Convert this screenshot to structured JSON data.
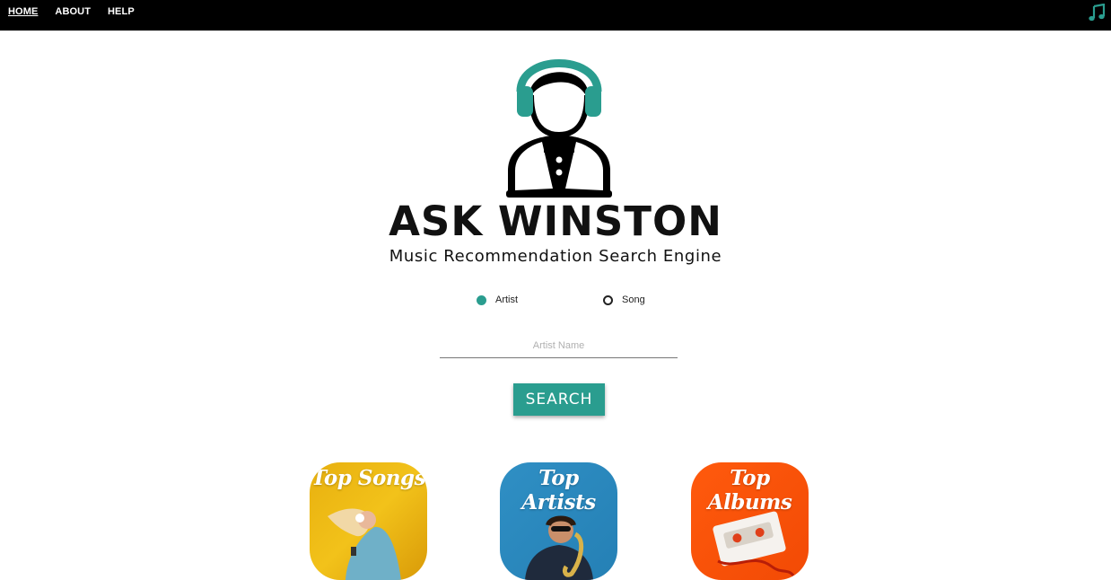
{
  "nav": {
    "items": [
      {
        "label": "HOME",
        "active": true
      },
      {
        "label": "ABOUT",
        "active": false
      },
      {
        "label": "HELP",
        "active": false
      }
    ],
    "music_icon": "music-note-icon"
  },
  "brand": {
    "logo_icon": "headphones-person-logo",
    "title": "ASK WINSTON",
    "subtitle": "Music Recommendation Search Engine"
  },
  "search_type": {
    "options": [
      {
        "label": "Artist",
        "checked": true
      },
      {
        "label": "Song",
        "checked": false
      }
    ]
  },
  "search": {
    "placeholder": "Artist Name",
    "value": "",
    "button_label": "SEARCH"
  },
  "tiles": [
    {
      "label": "Top Songs",
      "image": "woman-with-headphones-dancing"
    },
    {
      "label": "Top Artists",
      "image": "saxophone-player"
    },
    {
      "label": "Top Albums",
      "image": "cassette-tape"
    }
  ],
  "colors": {
    "accent": "#2a9d8f",
    "nav_bg": "#000000",
    "songs_tile": "#f2c21a",
    "artists_tile": "#2580b5",
    "albums_tile": "#f24a05"
  }
}
